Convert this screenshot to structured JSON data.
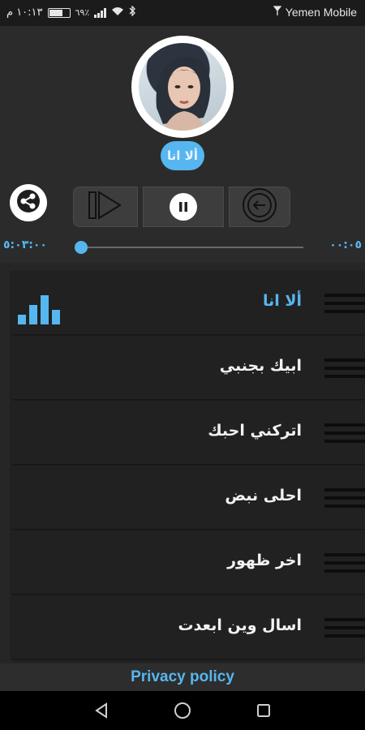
{
  "status_bar": {
    "time": "١٠:١٣ م",
    "battery_percent_label": "٦٩٪",
    "battery_level": 0.69,
    "carrier": "Yemen Mobile"
  },
  "player": {
    "current_song": "ألا انا",
    "elapsed": "٠٠:٠٥",
    "duration": "٥:٠٣:٠٠",
    "progress": 0.0,
    "accent_color": "#56b6ef"
  },
  "controls": {
    "share_icon": "share-icon",
    "next_icon": "skip-next-icon",
    "pause_icon": "pause-icon",
    "prev_icon": "back-arrow-icon"
  },
  "songs": [
    {
      "title": "ألا انا",
      "active": true
    },
    {
      "title": "ابيك بجنبي",
      "active": false
    },
    {
      "title": "اتركني احبك",
      "active": false
    },
    {
      "title": "احلى نبض",
      "active": false
    },
    {
      "title": "اخر ظهور",
      "active": false
    },
    {
      "title": "اسال وين ابعدت",
      "active": false
    }
  ],
  "footer": {
    "privacy_label": "Privacy policy"
  },
  "navbar": {
    "back_icon": "back-triangle-icon",
    "home_icon": "home-circle-icon",
    "recents_icon": "recents-square-icon"
  }
}
